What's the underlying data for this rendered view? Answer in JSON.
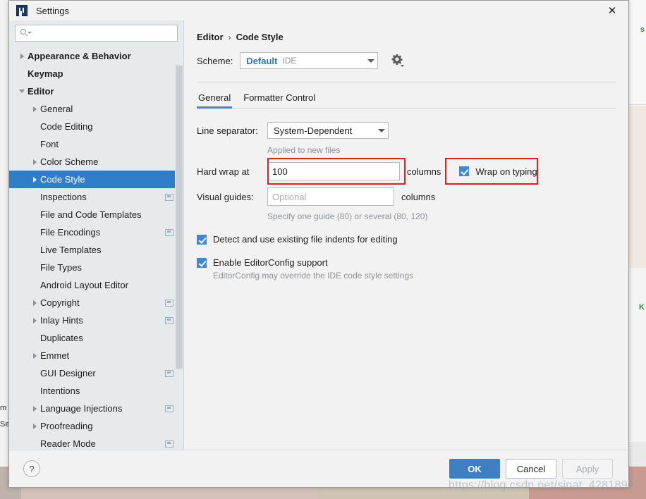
{
  "window": {
    "title": "Settings",
    "logo_icon": "intellij-idea-logo",
    "close_icon": "✕"
  },
  "sidebar": {
    "search": {
      "placeholder": "",
      "value": "",
      "icon": "search-icon"
    },
    "items": [
      {
        "label": "Appearance & Behavior",
        "arrow": "collapsed",
        "indent": 0,
        "bold": true,
        "badge": false,
        "selected": false
      },
      {
        "label": "Keymap",
        "arrow": "none",
        "indent": 0,
        "bold": true,
        "badge": false,
        "selected": false
      },
      {
        "label": "Editor",
        "arrow": "expanded",
        "indent": 0,
        "bold": true,
        "badge": false,
        "selected": false
      },
      {
        "label": "General",
        "arrow": "collapsed",
        "indent": 1,
        "bold": false,
        "badge": false,
        "selected": false
      },
      {
        "label": "Code Editing",
        "arrow": "none",
        "indent": 1,
        "bold": false,
        "badge": false,
        "selected": false
      },
      {
        "label": "Font",
        "arrow": "none",
        "indent": 1,
        "bold": false,
        "badge": false,
        "selected": false
      },
      {
        "label": "Color Scheme",
        "arrow": "collapsed",
        "indent": 1,
        "bold": false,
        "badge": false,
        "selected": false
      },
      {
        "label": "Code Style",
        "arrow": "collapsed",
        "indent": 1,
        "bold": false,
        "badge": false,
        "selected": true
      },
      {
        "label": "Inspections",
        "arrow": "none",
        "indent": 1,
        "bold": false,
        "badge": true,
        "selected": false
      },
      {
        "label": "File and Code Templates",
        "arrow": "none",
        "indent": 1,
        "bold": false,
        "badge": false,
        "selected": false
      },
      {
        "label": "File Encodings",
        "arrow": "none",
        "indent": 1,
        "bold": false,
        "badge": true,
        "selected": false
      },
      {
        "label": "Live Templates",
        "arrow": "none",
        "indent": 1,
        "bold": false,
        "badge": false,
        "selected": false
      },
      {
        "label": "File Types",
        "arrow": "none",
        "indent": 1,
        "bold": false,
        "badge": false,
        "selected": false
      },
      {
        "label": "Android Layout Editor",
        "arrow": "none",
        "indent": 1,
        "bold": false,
        "badge": false,
        "selected": false
      },
      {
        "label": "Copyright",
        "arrow": "collapsed",
        "indent": 1,
        "bold": false,
        "badge": true,
        "selected": false
      },
      {
        "label": "Inlay Hints",
        "arrow": "collapsed",
        "indent": 1,
        "bold": false,
        "badge": true,
        "selected": false
      },
      {
        "label": "Duplicates",
        "arrow": "none",
        "indent": 1,
        "bold": false,
        "badge": false,
        "selected": false
      },
      {
        "label": "Emmet",
        "arrow": "collapsed",
        "indent": 1,
        "bold": false,
        "badge": false,
        "selected": false
      },
      {
        "label": "GUI Designer",
        "arrow": "none",
        "indent": 1,
        "bold": false,
        "badge": true,
        "selected": false
      },
      {
        "label": "Intentions",
        "arrow": "none",
        "indent": 1,
        "bold": false,
        "badge": false,
        "selected": false
      },
      {
        "label": "Language Injections",
        "arrow": "collapsed",
        "indent": 1,
        "bold": false,
        "badge": true,
        "selected": false
      },
      {
        "label": "Proofreading",
        "arrow": "collapsed",
        "indent": 1,
        "bold": false,
        "badge": false,
        "selected": false
      },
      {
        "label": "Reader Mode",
        "arrow": "none",
        "indent": 1,
        "bold": false,
        "badge": true,
        "selected": false
      }
    ]
  },
  "content": {
    "breadcrumb": {
      "parent": "Editor",
      "separator": "›",
      "current": "Code Style"
    },
    "scheme": {
      "label": "Scheme:",
      "name": "Default",
      "kind": "IDE",
      "gear_icon": "gear-icon"
    },
    "tabs": [
      {
        "label": "General",
        "active": true
      },
      {
        "label": "Formatter Control",
        "active": false
      }
    ],
    "line_separator": {
      "label": "Line separator:",
      "value": "System-Dependent",
      "hint": "Applied to new files"
    },
    "hard_wrap": {
      "label": "Hard wrap at",
      "value": "100",
      "unit": "columns"
    },
    "wrap_on_typing": {
      "label": "Wrap on typing",
      "checked": true
    },
    "visual_guides": {
      "label": "Visual guides:",
      "value": "",
      "placeholder": "Optional",
      "unit": "columns",
      "hint": "Specify one guide (80) or several (80, 120)"
    },
    "detect_indents": {
      "label": "Detect and use existing file indents for editing",
      "checked": true
    },
    "editorconfig": {
      "label": "Enable EditorConfig support",
      "checked": true,
      "hint": "EditorConfig may override the IDE code style settings"
    }
  },
  "footer": {
    "help_label": "?",
    "ok_label": "OK",
    "cancel_label": "Cancel",
    "apply_label": "Apply"
  },
  "overlay": {
    "watermark": "https://blog.csdn.net/sinat_42818907",
    "annotation_color": "#ee1b1b"
  },
  "background": {
    "left_fragments": [
      "m",
      "Se"
    ],
    "right_fragments": [
      "s",
      "K"
    ]
  },
  "colors": {
    "accent": "#3e87d4",
    "selection": "#2f7ec9",
    "sidebar_bg": "#e6eaed",
    "content_bg": "#f2f2f2",
    "muted_text": "#8d9399",
    "scheme_name": "#2d6fc0"
  }
}
